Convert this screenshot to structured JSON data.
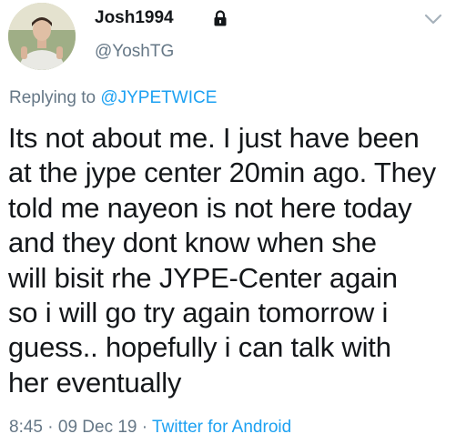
{
  "author": {
    "display_name": "Josh1994",
    "handle": "@YoshTG",
    "protected_icon": "lock-icon"
  },
  "menu_icon": "chevron-down-icon",
  "reply_context": {
    "prefix": "Replying to ",
    "mention": "@JYPETWICE"
  },
  "tweet_lines": [
    "Its not about me. I just have been",
    "at the jype center 20min ago. They",
    "told me nayeon is not here today",
    "and they dont know when she",
    "will bisit rhe JYPE-Center again",
    "so i will go try again tomorrow i",
    "guess.. hopefully i can talk with",
    "her eventually"
  ],
  "meta": {
    "time": "8:45",
    "sep1": " · ",
    "date": "09 Dec 19",
    "sep2": " · ",
    "source": "Twitter for Android"
  },
  "colors": {
    "link": "#1da1f2",
    "secondary": "#657786",
    "primary": "#14171a"
  }
}
